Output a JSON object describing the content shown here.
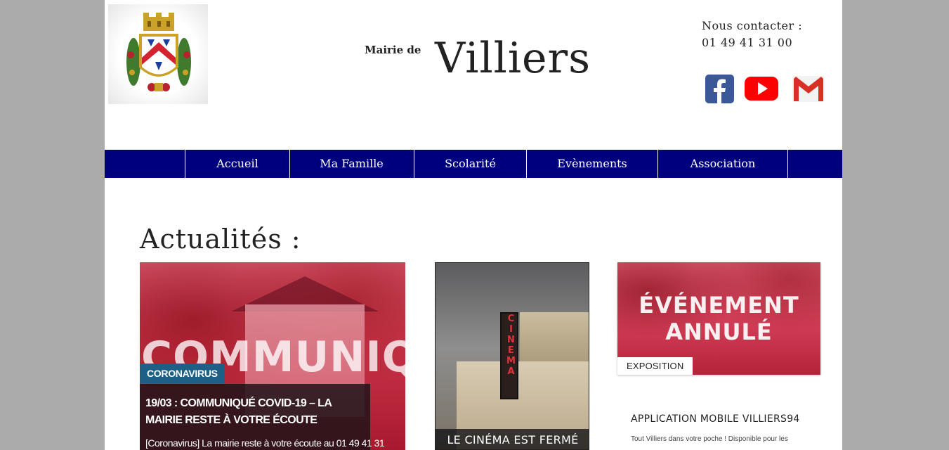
{
  "header": {
    "mairie_label": "Mairie de",
    "town_name": "Villiers",
    "contact_label": "Nous contacter :",
    "contact_phone": "01 49 41 31 00",
    "social": [
      {
        "name": "facebook-icon",
        "color": "#3b5998"
      },
      {
        "name": "youtube-icon",
        "color": "#ff0000"
      },
      {
        "name": "gmail-icon",
        "color": "#d93025"
      }
    ]
  },
  "nav": {
    "items": [
      {
        "label": "Accueil"
      },
      {
        "label": "Ma Famille"
      },
      {
        "label": "Scolarité"
      },
      {
        "label": "Evènements"
      },
      {
        "label": "Association"
      }
    ],
    "color": "#00007f"
  },
  "news": {
    "title": "Actualités :",
    "card1": {
      "image_text": "COMMUNIQUÉ",
      "tag": "CORONAVIRUS",
      "headline": "19/03 : COMMUNIQUÉ COVID-19 – LA MAIRIE RESTE À VOTRE ÉCOUTE",
      "excerpt": "[Coronavirus] La mairie reste à votre écoute au 01 49 41 31"
    },
    "card2": {
      "sign_text": "CINEMA",
      "caption": "LE CINÉMA EST FERMÉ"
    },
    "card3": {
      "image_line1": "ÉVÉNEMENT",
      "image_line2": "ANNULÉ",
      "tag": "EXPOSITION"
    },
    "app": {
      "title": "APPLICATION MOBILE VILLIERS94",
      "description": "Tout Villiers dans votre poche ! Disponible pour les"
    }
  }
}
